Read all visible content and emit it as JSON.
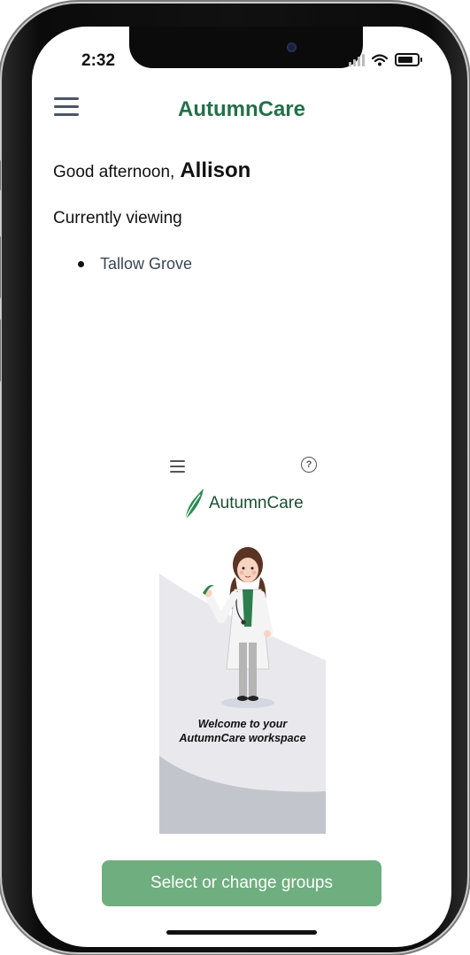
{
  "status_bar": {
    "time": "2:32"
  },
  "header": {
    "title": "AutumnCare"
  },
  "greeting": {
    "prefix": "Good afternoon,",
    "name": "Allison"
  },
  "viewing": {
    "label": "Currently viewing",
    "groups": [
      "Tallow Grove"
    ]
  },
  "illustration": {
    "brand": "AutumnCare",
    "welcome_line1": "Welcome to your",
    "welcome_line2": "AutumnCare workspace"
  },
  "actions": {
    "select_groups": "Select or change groups"
  },
  "colors": {
    "brand_green": "#23704a",
    "button_green": "#6fae7f"
  },
  "icons": {
    "menu": "hamburger-menu-icon",
    "help": "question-circle-icon",
    "brand": "leaf-logo-icon"
  }
}
